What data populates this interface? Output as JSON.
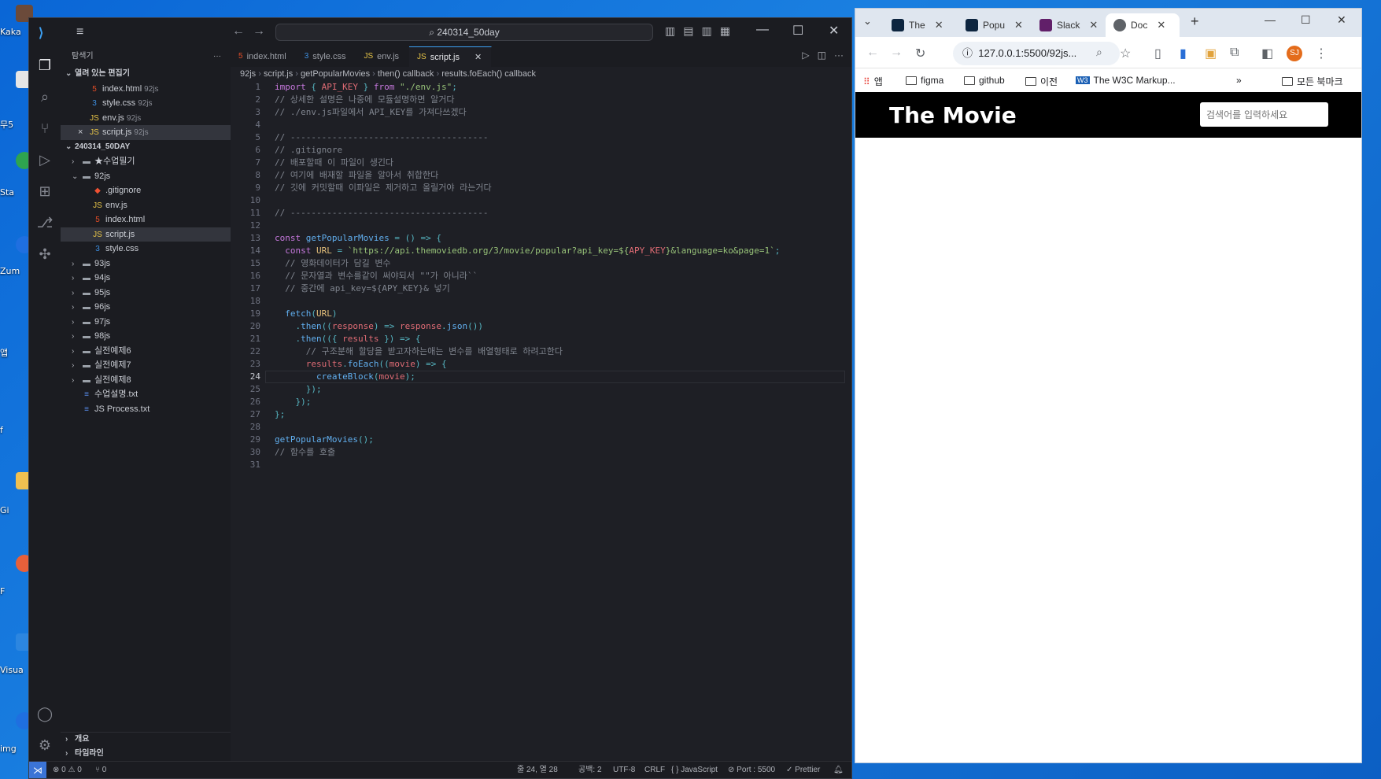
{
  "desktop": {
    "labels": [
      "Kaka",
      "무5",
      "Sta",
      "Zum",
      "앱",
      "f",
      "Gi",
      "F",
      "Visua",
      "img"
    ]
  },
  "vscode": {
    "search": "240314_50day",
    "explorer_title": "탐색기",
    "open_editors_label": "열려 있는 편집기",
    "open_editors": [
      {
        "name": "index.html",
        "sub": "92js",
        "icon": "html"
      },
      {
        "name": "style.css",
        "sub": "92js",
        "icon": "css"
      },
      {
        "name": "env.js",
        "sub": "92js",
        "icon": "js"
      },
      {
        "name": "script.js",
        "sub": "92js",
        "icon": "js",
        "close": "×"
      }
    ],
    "workspace_label": "240314_50DAY",
    "tree": [
      {
        "name": "★수업필기",
        "type": "folder",
        "depth": 1
      },
      {
        "name": "92js",
        "type": "folder-open",
        "depth": 1
      },
      {
        "name": ".gitignore",
        "type": "git",
        "depth": 2
      },
      {
        "name": "env.js",
        "type": "js",
        "depth": 2
      },
      {
        "name": "index.html",
        "type": "html",
        "depth": 2
      },
      {
        "name": "script.js",
        "type": "js",
        "depth": 2,
        "selected": true
      },
      {
        "name": "style.css",
        "type": "css",
        "depth": 2
      },
      {
        "name": "93js",
        "type": "folder",
        "depth": 1
      },
      {
        "name": "94js",
        "type": "folder",
        "depth": 1
      },
      {
        "name": "95js",
        "type": "folder",
        "depth": 1
      },
      {
        "name": "96js",
        "type": "folder",
        "depth": 1
      },
      {
        "name": "97js",
        "type": "folder",
        "depth": 1
      },
      {
        "name": "98js",
        "type": "folder",
        "depth": 1
      },
      {
        "name": "실전예제6",
        "type": "folder",
        "depth": 1
      },
      {
        "name": "실전예제7",
        "type": "folder",
        "depth": 1
      },
      {
        "name": "실전예제8",
        "type": "folder",
        "depth": 1
      },
      {
        "name": "수업설명.txt",
        "type": "txt",
        "depth": 1
      },
      {
        "name": "JS Process.txt",
        "type": "txt",
        "depth": 1
      }
    ],
    "outline_label": "개요",
    "timeline_label": "타임라인",
    "tabs": [
      {
        "label": "index.html",
        "icon": "html"
      },
      {
        "label": "style.css",
        "icon": "css"
      },
      {
        "label": "env.js",
        "icon": "js"
      },
      {
        "label": "script.js",
        "icon": "js",
        "active": true
      }
    ],
    "breadcrumbs": [
      "92js",
      "script.js",
      "getPopularMovies",
      "then() callback",
      "results.foEach() callback"
    ],
    "code": [
      [
        [
          "k",
          "import"
        ],
        [
          "",
          ""
        ],
        [
          "o",
          " { "
        ],
        [
          "v",
          "API_KEY"
        ],
        [
          "o",
          " } "
        ],
        [
          "k",
          "from"
        ],
        [
          "s",
          " \"./env.js\""
        ],
        [
          "o",
          ";"
        ]
      ],
      [
        [
          "c",
          "// 상세한 설명은 나중에 모듈설명하면 알거다"
        ]
      ],
      [
        [
          "c",
          "// ./env.js파일에서 API_KEY를 가져다쓰겠다"
        ]
      ],
      [],
      [
        [
          "c",
          "// --------------------------------------"
        ]
      ],
      [
        [
          "c",
          "// .gitignore"
        ]
      ],
      [
        [
          "c",
          "// 배포할때 이 파일이 생긴다"
        ]
      ],
      [
        [
          "c",
          "// 여기에 배재할 파일을 알아서 취합한다"
        ]
      ],
      [
        [
          "c",
          "// 깃에 커밋할때 이파일은 제거하고 올릴거야 라는거다"
        ]
      ],
      [],
      [
        [
          "c",
          "// --------------------------------------"
        ]
      ],
      [],
      [
        [
          "k",
          "const "
        ],
        [
          "f",
          "getPopularMovies"
        ],
        [
          "o",
          " = () => {"
        ]
      ],
      [
        [
          "",
          ""
        ],
        [
          "k",
          "  const "
        ],
        [
          "t",
          "URL"
        ],
        [
          "o",
          " = "
        ],
        [
          "s",
          "`https://api.themoviedb.org/3/movie/popular?api_key=${"
        ],
        [
          "v",
          "APY_KEY"
        ],
        [
          "s",
          "}&language=ko&page=1`"
        ],
        [
          "o",
          ";"
        ]
      ],
      [
        [
          "c",
          "  // 영화데이터가 담길 변수"
        ]
      ],
      [
        [
          "c",
          "  // 문자열과 변수를같이 써야되서 \"\"가 아니라``"
        ]
      ],
      [
        [
          "c",
          "  // 중간에 api_key=${APY_KEY}& 넣기"
        ]
      ],
      [],
      [
        [
          "f",
          "  fetch"
        ],
        [
          "o",
          "("
        ],
        [
          "t",
          "URL"
        ],
        [
          "o",
          ")"
        ]
      ],
      [
        [
          "o",
          "    ."
        ],
        [
          "f",
          "then"
        ],
        [
          "o",
          "(("
        ],
        [
          "v",
          "response"
        ],
        [
          "o",
          ") => "
        ],
        [
          "v",
          "response"
        ],
        [
          "o",
          "."
        ],
        [
          "f",
          "json"
        ],
        [
          "o",
          "())"
        ]
      ],
      [
        [
          "o",
          "    ."
        ],
        [
          "f",
          "then"
        ],
        [
          "o",
          "(({ "
        ],
        [
          "v",
          "results"
        ],
        [
          "o",
          " }) => {"
        ]
      ],
      [
        [
          "c",
          "      // 구조분해 할당을 받고자하는애는 변수를 배열형태로 하려고한다"
        ]
      ],
      [
        [
          "v",
          "      results"
        ],
        [
          "o",
          "."
        ],
        [
          "f",
          "foEach"
        ],
        [
          "o",
          "(("
        ],
        [
          "v",
          "movie"
        ],
        [
          "o",
          ") => {"
        ]
      ],
      [
        [
          "f",
          "        createBlock"
        ],
        [
          "o",
          "("
        ],
        [
          "v",
          "movie"
        ],
        [
          "o",
          ");"
        ]
      ],
      [
        [
          "o",
          "      });"
        ]
      ],
      [
        [
          "o",
          "    });"
        ]
      ],
      [
        [
          "o",
          "};"
        ]
      ],
      [],
      [
        [
          "f",
          "getPopularMovies"
        ],
        [
          "o",
          "();"
        ]
      ],
      [
        [
          "c",
          "// 함수를 호출"
        ]
      ],
      []
    ],
    "current_line": 24,
    "status": {
      "errors": "⊗ 0 ⚠ 0",
      "ports": "⑂ 0",
      "position": "줄 24, 열 28",
      "spaces": "공백: 2",
      "encoding": "UTF-8",
      "eol": "CRLF",
      "language": "{ } JavaScript",
      "port": "⊘ Port : 5500",
      "prettier": "✓ Prettier"
    }
  },
  "chrome": {
    "tabs": [
      {
        "label": "The",
        "color": "#0d253f"
      },
      {
        "label": "Popu",
        "color": "#0d253f"
      },
      {
        "label": "Slack",
        "color": "#611f69"
      },
      {
        "label": "Doc",
        "color": "#5f6368",
        "active": true
      }
    ],
    "url": "127.0.0.1:5500/92js...",
    "profile": "SJ",
    "bookmarks": [
      "앱",
      "figma",
      "github",
      "이전",
      "The W3C Markup...",
      "모든 북마크"
    ],
    "page": {
      "title": "The Movie",
      "search_placeholder": "검색어를 입력하세요"
    }
  }
}
